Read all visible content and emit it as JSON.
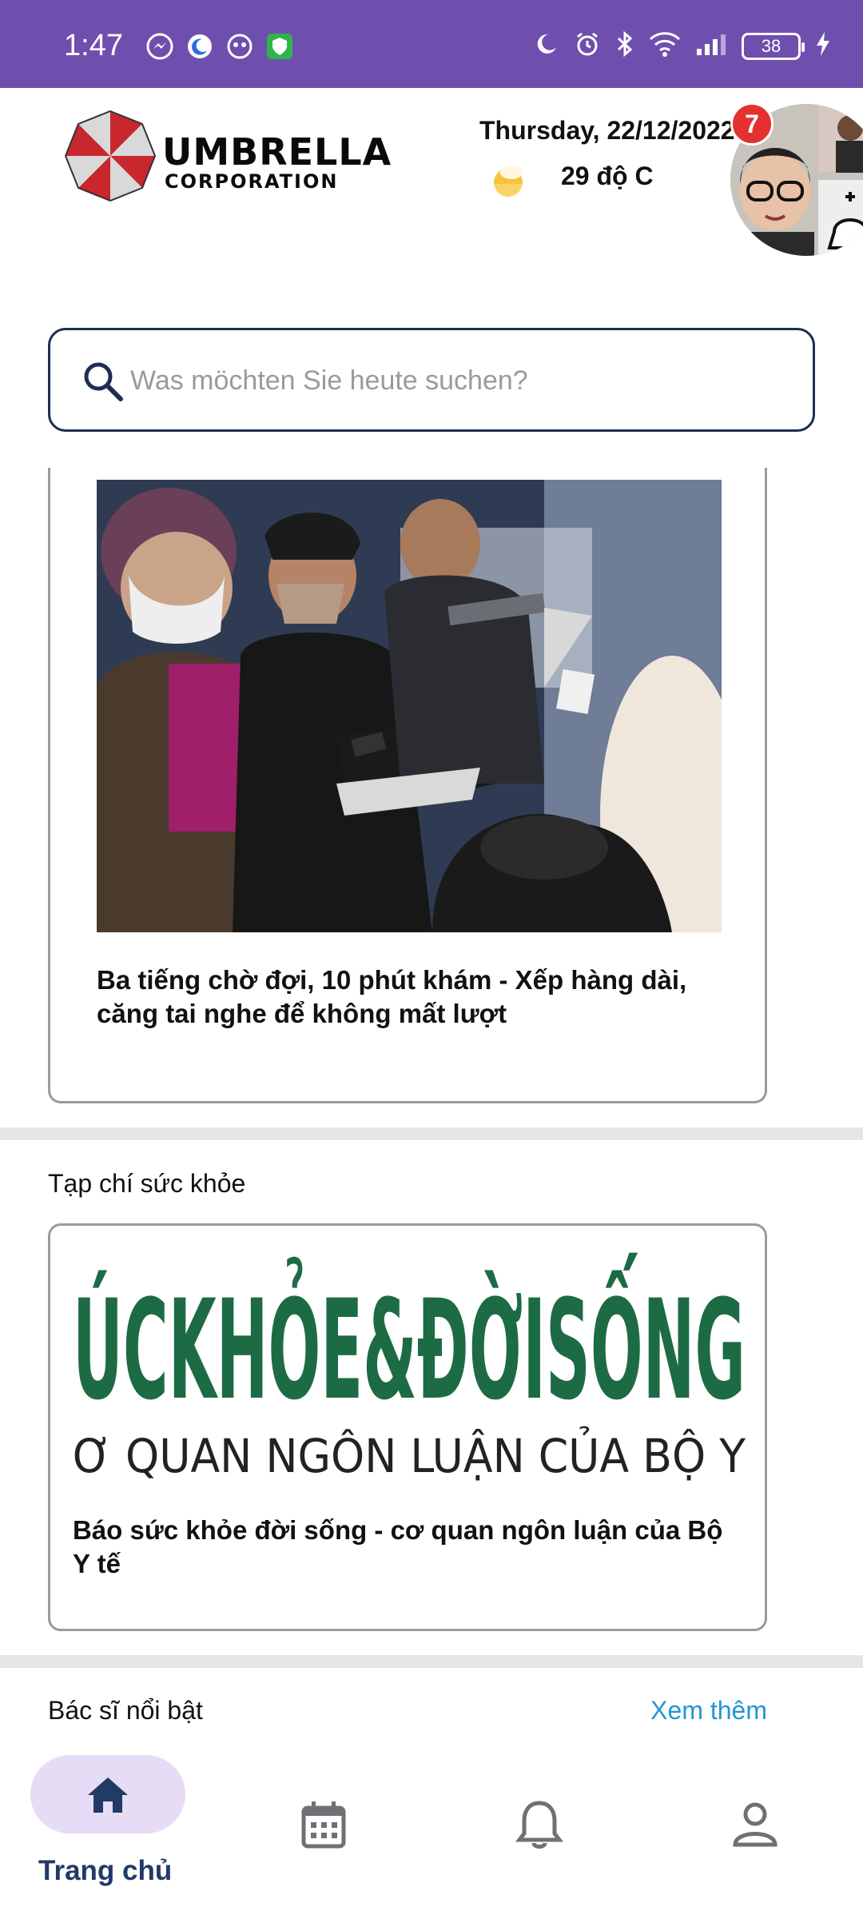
{
  "status_bar": {
    "time": "1:47",
    "battery": "38"
  },
  "header": {
    "logo_line1": "UMBRELLA",
    "logo_line2": "CORPORATION",
    "date": "Thursday, 22/12/2022",
    "temperature": "29 độ C",
    "notification_count": "7"
  },
  "search": {
    "placeholder": "Was möchten Sie heute suchen?"
  },
  "news_card": {
    "title": "Ba tiếng chờ đợi, 10 phút khám - Xếp hàng dài, căng tai nghe để không mất lượt"
  },
  "magazine_section": {
    "heading": "Tạp chí sức khỏe",
    "banner_line1": "ÚCKHỎE&ĐỜISỐNG",
    "banner_line2": "Ơ QUAN NGÔN LUẬN CỦA BỘ Y",
    "card_title": "Báo sức khỏe đời sống - cơ quan ngôn luận của Bộ Y tế"
  },
  "doctors_section": {
    "heading": "Bác sĩ nổi bật",
    "see_more": "Xem thêm"
  },
  "bottom_nav": {
    "home_label": "Trang chủ",
    "items": [
      "home-icon",
      "calendar-icon",
      "bell-icon",
      "account-icon"
    ]
  },
  "colors": {
    "status_bar": "#6f4fae",
    "accent_dark": "#213a66",
    "link": "#2196d6",
    "nav_pill": "#e6dcf5",
    "badge": "#e53030"
  }
}
